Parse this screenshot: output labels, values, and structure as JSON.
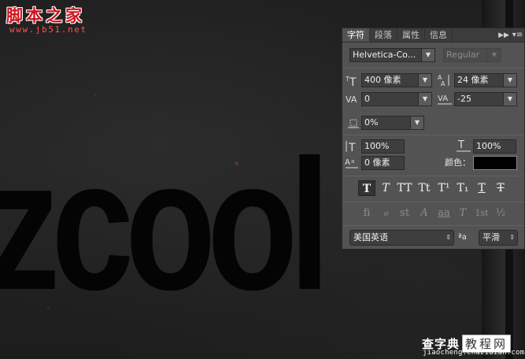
{
  "watermark": {
    "site_title": "脚本之家",
    "site_url": "www.jb51.net",
    "bottom_title": "查字典",
    "bottom_boxed": "教程网",
    "bottom_url": "jiaocheng.chazidian.com"
  },
  "canvas": {
    "text": "zcool",
    "text_color": "#040404"
  },
  "panel": {
    "tabs": [
      {
        "label": "字符",
        "active": true
      },
      {
        "label": "段落",
        "active": false
      },
      {
        "label": "属性",
        "active": false
      },
      {
        "label": "信息",
        "active": false
      }
    ],
    "expand_icon": "double-chevron-right-icon",
    "menu_icon": "panel-menu-icon",
    "font_family": "Helvetica-Co...",
    "font_style": "Regular",
    "font_size": "400 像素",
    "leading": "24 像素",
    "kerning": "0",
    "tracking": "-25",
    "tsume": "0%",
    "vertical_scale": "100%",
    "horizontal_scale": "100%",
    "baseline_shift": "0 像素",
    "color_label": "颜色：",
    "color_value": "#000000",
    "type_styles": [
      {
        "name": "faux-bold",
        "glyph": "T",
        "active": true
      },
      {
        "name": "faux-italic",
        "glyph": "T",
        "active": false
      },
      {
        "name": "all-caps",
        "glyph": "TT",
        "active": false
      },
      {
        "name": "small-caps",
        "glyph": "Tt",
        "active": false
      },
      {
        "name": "superscript",
        "glyph": "T¹",
        "active": false
      },
      {
        "name": "subscript",
        "glyph": "T₁",
        "active": false
      },
      {
        "name": "underline",
        "glyph": "T",
        "active": false
      },
      {
        "name": "strikethrough",
        "glyph": "T",
        "active": false
      }
    ],
    "opentype": [
      {
        "name": "standard-ligatures",
        "glyph": "fi"
      },
      {
        "name": "contextual-alternates",
        "glyph": "ℴ"
      },
      {
        "name": "discretionary-ligatures",
        "glyph": "st"
      },
      {
        "name": "swash",
        "glyph": "A"
      },
      {
        "name": "stylistic-alternates",
        "glyph": "aa"
      },
      {
        "name": "titling-alternates",
        "glyph": "T"
      },
      {
        "name": "ordinals",
        "glyph": "1st"
      },
      {
        "name": "fractions",
        "glyph": "½"
      }
    ],
    "language": "美国英语",
    "antialias_label": "ªa",
    "antialias": "平滑"
  }
}
